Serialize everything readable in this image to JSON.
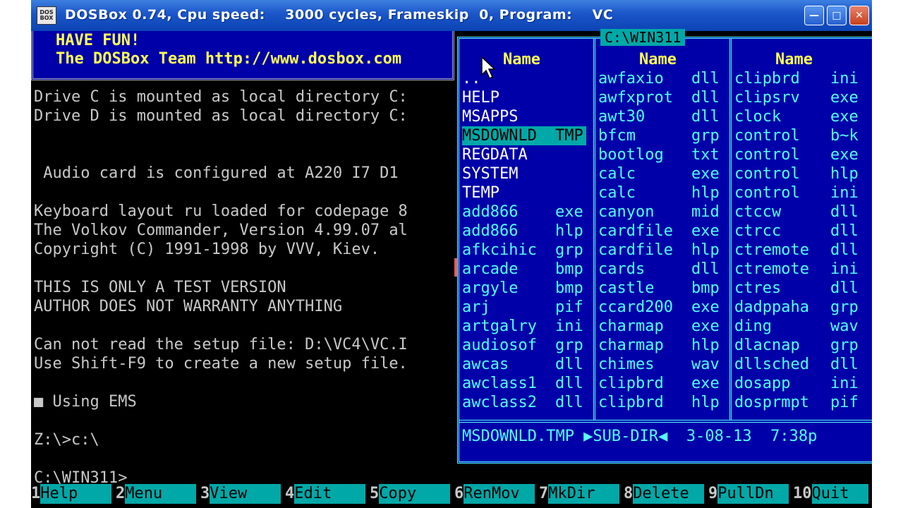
{
  "window": {
    "title": "DOSBox 0.74, Cpu speed:    3000 cycles, Frameskip  0, Program:    VC",
    "icon_name": "dosbox-icon",
    "buttons": [
      "minimize-icon",
      "maximize-icon",
      "close-icon"
    ]
  },
  "banner": {
    "line1": "HAVE FUN!",
    "line2": "The DOSBox Team http://www.dosbox.com"
  },
  "console": {
    "lines": [
      "Drive C is mounted as local directory C:",
      "Drive D is mounted as local directory C:",
      " Audio card is configured at A220 I7 D1",
      "Keyboard layout ru loaded for codepage 8",
      "The Volkov Commander, Version 4.99.07 al",
      "Copyright (C) 1991-1998 by VVV, Kiev.",
      "THIS IS ONLY A TEST VERSION",
      "AUTHOR DOES NOT WARRANTY ANYTHING",
      "Can not read the setup file: D:\\VC4\\VC.I",
      "Use Shift-F9 to create a new setup file.",
      "■ Using EMS",
      "Z:\\>c:\\",
      "C:\\WIN311>"
    ]
  },
  "panel": {
    "path": "C:\\WIN311",
    "header": "Name",
    "col1": [
      {
        "name": "..",
        "ext": "",
        "dir": true
      },
      {
        "name": "HELP",
        "ext": "",
        "dir": true
      },
      {
        "name": "MSAPPS",
        "ext": "",
        "dir": true
      },
      {
        "name": "MSDOWNLD",
        "ext": "TMP",
        "dir": true,
        "selected": true
      },
      {
        "name": "REGDATA",
        "ext": "",
        "dir": true
      },
      {
        "name": "SYSTEM",
        "ext": "",
        "dir": true
      },
      {
        "name": "TEMP",
        "ext": "",
        "dir": true
      },
      {
        "name": "add866",
        "ext": "exe"
      },
      {
        "name": "add866",
        "ext": "hlp"
      },
      {
        "name": "afkcihic",
        "ext": "grp"
      },
      {
        "name": "arcade",
        "ext": "bmp"
      },
      {
        "name": "argyle",
        "ext": "bmp"
      },
      {
        "name": "arj",
        "ext": "pif"
      },
      {
        "name": "artgalry",
        "ext": "ini"
      },
      {
        "name": "audiosof",
        "ext": "grp"
      },
      {
        "name": "awcas",
        "ext": "dll"
      },
      {
        "name": "awclass1",
        "ext": "dll"
      },
      {
        "name": "awclass2",
        "ext": "dll"
      }
    ],
    "col2": [
      {
        "name": "awfaxio",
        "ext": "dll"
      },
      {
        "name": "awfxprot",
        "ext": "dll"
      },
      {
        "name": "awt30",
        "ext": "dll"
      },
      {
        "name": "bfcm",
        "ext": "grp"
      },
      {
        "name": "bootlog",
        "ext": "txt"
      },
      {
        "name": "calc",
        "ext": "exe"
      },
      {
        "name": "calc",
        "ext": "hlp"
      },
      {
        "name": "canyon",
        "ext": "mid"
      },
      {
        "name": "cardfile",
        "ext": "exe"
      },
      {
        "name": "cardfile",
        "ext": "hlp"
      },
      {
        "name": "cards",
        "ext": "dll"
      },
      {
        "name": "castle",
        "ext": "bmp"
      },
      {
        "name": "ccard200",
        "ext": "exe"
      },
      {
        "name": "charmap",
        "ext": "exe"
      },
      {
        "name": "charmap",
        "ext": "hlp"
      },
      {
        "name": "chimes",
        "ext": "wav"
      },
      {
        "name": "clipbrd",
        "ext": "exe"
      },
      {
        "name": "clipbrd",
        "ext": "hlp"
      }
    ],
    "col3": [
      {
        "name": "clipbrd",
        "ext": "ini"
      },
      {
        "name": "clipsrv",
        "ext": "exe"
      },
      {
        "name": "clock",
        "ext": "exe"
      },
      {
        "name": "control",
        "ext": "b~k"
      },
      {
        "name": "control",
        "ext": "exe"
      },
      {
        "name": "control",
        "ext": "hlp"
      },
      {
        "name": "control",
        "ext": "ini"
      },
      {
        "name": "ctccw",
        "ext": "dll"
      },
      {
        "name": "ctrcc",
        "ext": "dll"
      },
      {
        "name": "ctremote",
        "ext": "dll"
      },
      {
        "name": "ctremote",
        "ext": "ini"
      },
      {
        "name": "ctres",
        "ext": "dll"
      },
      {
        "name": "dadppaha",
        "ext": "grp"
      },
      {
        "name": "ding",
        "ext": "wav"
      },
      {
        "name": "dlacnap",
        "ext": "grp"
      },
      {
        "name": "dllsched",
        "ext": "dll"
      },
      {
        "name": "dosapp",
        "ext": "ini"
      },
      {
        "name": "dosprmpt",
        "ext": "pif"
      }
    ],
    "status": "MSDOWNLD.TMP ▶SUB-DIR◀  3-08-13  7:38p"
  },
  "fkeys": [
    {
      "num": "1",
      "label": "Help"
    },
    {
      "num": "2",
      "label": "Menu"
    },
    {
      "num": "3",
      "label": "View"
    },
    {
      "num": "4",
      "label": "Edit"
    },
    {
      "num": "5",
      "label": "Copy"
    },
    {
      "num": "6",
      "label": "RenMov"
    },
    {
      "num": "7",
      "label": "MkDir"
    },
    {
      "num": "8",
      "label": "Delete"
    },
    {
      "num": "9",
      "label": "PullDn"
    },
    {
      "num": "10",
      "label": "Quit"
    }
  ]
}
